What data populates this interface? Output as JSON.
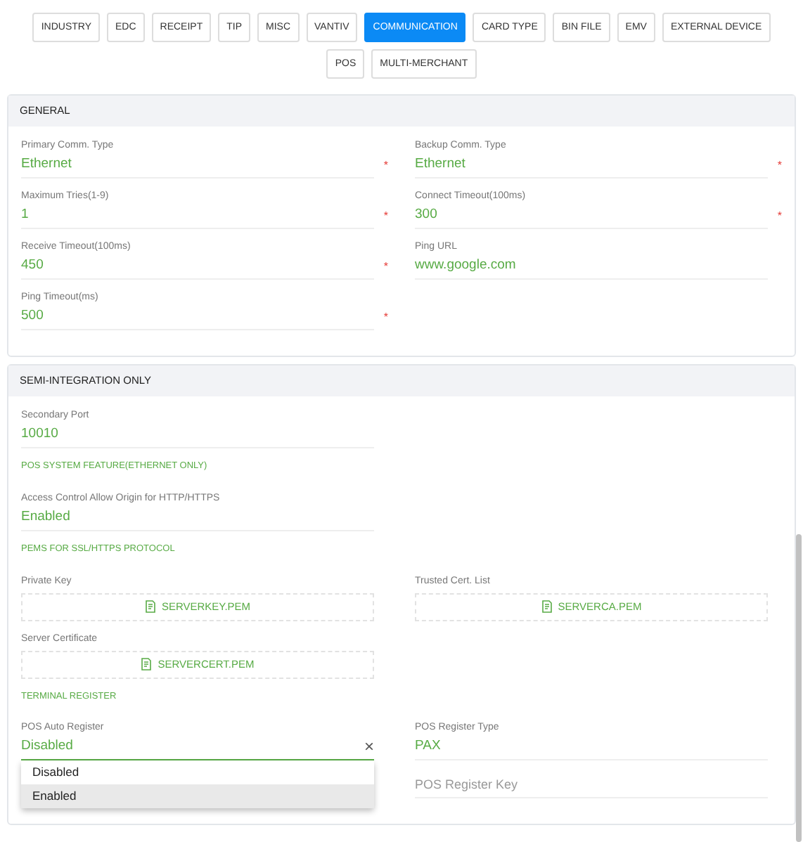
{
  "tabs": [
    {
      "label": "INDUSTRY",
      "selected": false
    },
    {
      "label": "EDC",
      "selected": false
    },
    {
      "label": "RECEIPT",
      "selected": false
    },
    {
      "label": "TIP",
      "selected": false
    },
    {
      "label": "MISC",
      "selected": false
    },
    {
      "label": "VANTIV",
      "selected": false
    },
    {
      "label": "COMMUNICATION",
      "selected": true
    },
    {
      "label": "CARD TYPE",
      "selected": false
    },
    {
      "label": "BIN FILE",
      "selected": false
    },
    {
      "label": "EMV",
      "selected": false
    },
    {
      "label": "EXTERNAL DEVICE",
      "selected": false
    },
    {
      "label": "POS",
      "selected": false
    },
    {
      "label": "MULTI-MERCHANT",
      "selected": false
    }
  ],
  "sections": [
    {
      "title": "GENERAL",
      "rows": [
        {
          "kind": "pair",
          "cells": [
            {
              "kind": "field",
              "label": "Primary Comm. Type",
              "value": "Ethernet",
              "required_mark": "*"
            },
            {
              "kind": "field",
              "label": "Backup Comm. Type",
              "value": "Ethernet",
              "required_mark": "*"
            }
          ]
        },
        {
          "kind": "pair",
          "cells": [
            {
              "kind": "field",
              "label": "Maximum Tries(1-9)",
              "value": "1",
              "required_mark": "*"
            },
            {
              "kind": "field",
              "label": "Connect Timeout(100ms)",
              "value": "300",
              "required_mark": "*"
            }
          ]
        },
        {
          "kind": "pair",
          "cells": [
            {
              "kind": "field",
              "label": "Receive Timeout(100ms)",
              "value": "450",
              "required_mark": "*"
            },
            {
              "kind": "field",
              "label": "Ping URL",
              "value": "www.google.com"
            }
          ]
        },
        {
          "kind": "pair",
          "cells": [
            {
              "kind": "field",
              "label": "Ping Timeout(ms)",
              "value": "500",
              "required_mark": "*"
            }
          ]
        }
      ]
    },
    {
      "title": "SEMI-INTEGRATION ONLY",
      "rows": [
        {
          "kind": "pair",
          "cells": [
            {
              "kind": "field",
              "label": "Secondary Port",
              "value": "10010"
            }
          ]
        },
        {
          "kind": "subheading",
          "text": "POS SYSTEM FEATURE(ETHERNET ONLY)"
        },
        {
          "kind": "pair",
          "cells": [
            {
              "kind": "field",
              "label": "Access Control Allow Origin for HTTP/HTTPS",
              "value": "Enabled"
            }
          ]
        },
        {
          "kind": "subheading",
          "text": "PEMS FOR SSL/HTTPS PROTOCOL"
        },
        {
          "kind": "pair",
          "cells": [
            {
              "kind": "file",
              "label": "Private Key",
              "file": "SERVERKEY.PEM"
            },
            {
              "kind": "file",
              "label": "Trusted Cert. List",
              "file": "SERVERCA.PEM"
            }
          ]
        },
        {
          "kind": "pair",
          "cells": [
            {
              "kind": "file",
              "label": "Server Certificate",
              "file": "SERVERCERT.PEM"
            }
          ]
        },
        {
          "kind": "subheading",
          "text": "TERMINAL REGISTER"
        },
        {
          "kind": "pair",
          "cells": [
            {
              "kind": "select",
              "label": "POS Auto Register",
              "value": "Disabled",
              "clear": "×",
              "options": [
                {
                  "label": "Disabled",
                  "highlighted": false
                },
                {
                  "label": "Enabled",
                  "highlighted": true
                }
              ]
            },
            {
              "kind": "field",
              "label": "POS Register Type",
              "value": "PAX"
            }
          ]
        },
        {
          "kind": "pair",
          "cells": [
            {
              "kind": "empty"
            },
            {
              "kind": "field",
              "placeholder": "POS Register Key"
            }
          ]
        }
      ]
    }
  ]
}
